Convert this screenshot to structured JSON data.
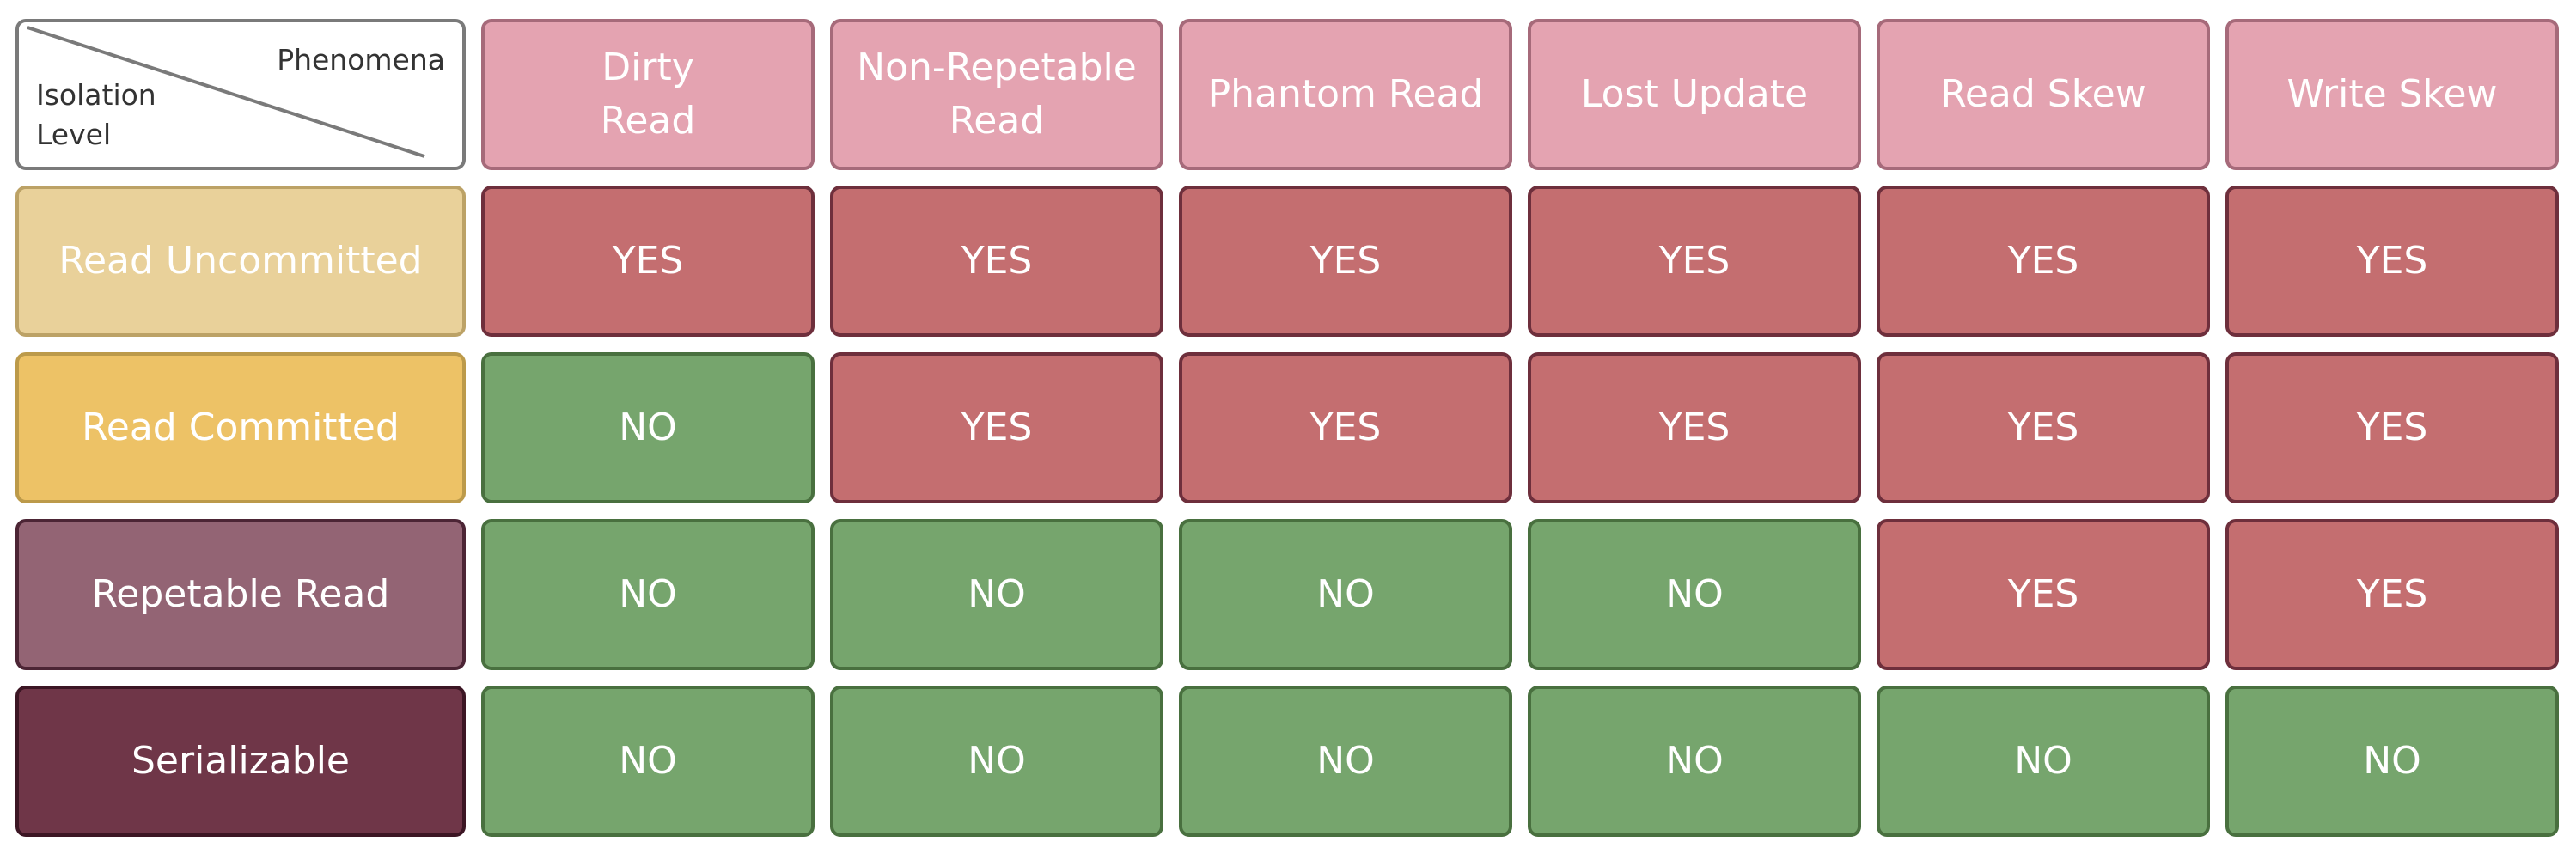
{
  "corner": {
    "top_right_label": "Phenomena",
    "bottom_left_label": "Isolation\nLevel"
  },
  "phenomena": [
    {
      "label": "Dirty\nRead"
    },
    {
      "label": "Non-Repetable\nRead"
    },
    {
      "label": "Phantom Read"
    },
    {
      "label": "Lost Update"
    },
    {
      "label": "Read Skew"
    },
    {
      "label": "Write Skew"
    }
  ],
  "levels": [
    {
      "label": "Read Uncommitted",
      "bg": "#e9d19a",
      "border": "#bca266",
      "cells": [
        "YES",
        "YES",
        "YES",
        "YES",
        "YES",
        "YES"
      ]
    },
    {
      "label": "Read Committed",
      "bg": "#edc266",
      "border": "#bc9a4a",
      "cells": [
        "NO",
        "YES",
        "YES",
        "YES",
        "YES",
        "YES"
      ]
    },
    {
      "label": "Repetable Read",
      "bg": "#936474",
      "border": "#4c2535",
      "cells": [
        "NO",
        "NO",
        "NO",
        "NO",
        "YES",
        "YES"
      ]
    },
    {
      "label": "Serializable",
      "bg": "#6f3648",
      "border": "#3c1624",
      "cells": [
        "NO",
        "NO",
        "NO",
        "NO",
        "NO",
        "NO"
      ]
    }
  ],
  "colors": {
    "header_bg": "#e4a3b1",
    "yes_bg": "#c46e70",
    "no_bg": "#76a56d"
  }
}
